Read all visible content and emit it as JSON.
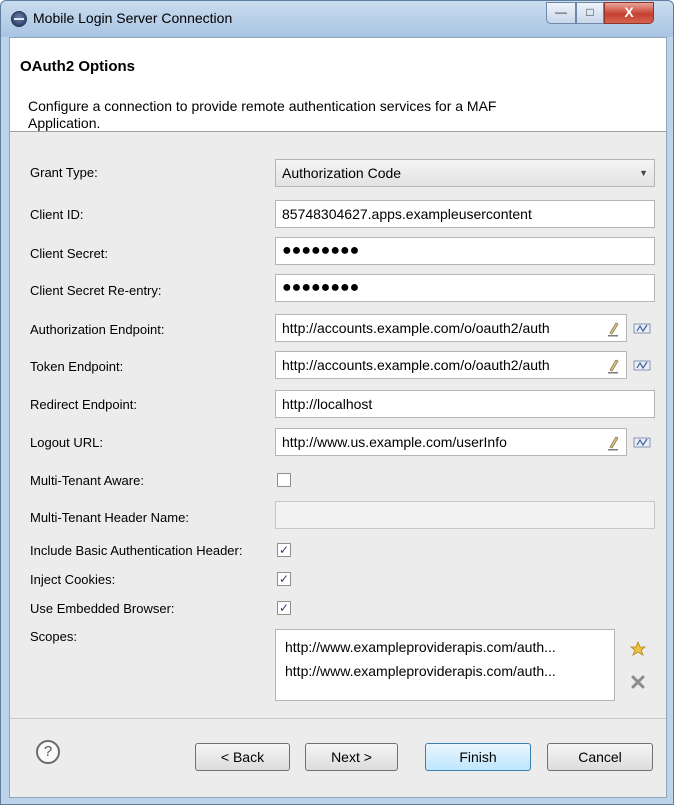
{
  "window": {
    "title": "Mobile Login Server Connection",
    "minimize": "—",
    "maximize": "□",
    "close": "X"
  },
  "header": {
    "title": "OAuth2 Options",
    "description": "Configure a connection to provide remote authentication services for a MAF Application."
  },
  "form": {
    "grant_type": {
      "label": "Grant Type:",
      "value": "Authorization Code"
    },
    "client_id": {
      "label": "Client ID:",
      "value": "85748304627.apps.exampleusercontent"
    },
    "client_secret": {
      "label": "Client Secret:",
      "value": "●●●●●●●●"
    },
    "client_secret_reentry": {
      "label": "Client Secret Re-entry:",
      "value": "●●●●●●●●"
    },
    "authorization_endpoint": {
      "label": "Authorization Endpoint:",
      "value": "http://accounts.example.com/o/oauth2/auth"
    },
    "token_endpoint": {
      "label": "Token Endpoint:",
      "value": "http://accounts.example.com/o/oauth2/auth"
    },
    "redirect_endpoint": {
      "label": "Redirect Endpoint:",
      "value": "http://localhost"
    },
    "logout_url": {
      "label": "Logout URL:",
      "value": "http://www.us.example.com/userInfo"
    },
    "multi_tenant_aware": {
      "label": "Multi-Tenant Aware:",
      "checked": false
    },
    "multi_tenant_header": {
      "label": "Multi-Tenant Header Name:",
      "value": ""
    },
    "include_basic_auth": {
      "label": "Include Basic Authentication Header:",
      "checked": true
    },
    "inject_cookies": {
      "label": "Inject Cookies:",
      "checked": true
    },
    "use_embedded_browser": {
      "label": "Use Embedded Browser:",
      "checked": true
    },
    "scopes": {
      "label": "Scopes:",
      "items": [
        "http://www.exampleproviderapis.com/auth...",
        "http://www.exampleproviderapis.com/auth..."
      ]
    },
    "check_mark": "✓",
    "select_arrow": "▼"
  },
  "buttons": {
    "help": "?",
    "back": "< Back",
    "next": "Next >",
    "finish": "Finish",
    "cancel": "Cancel"
  },
  "icons": {
    "window": "app-icon",
    "edit": "edit-icon",
    "variable": "variable-icon",
    "add": "add-scope-icon",
    "remove": "remove-scope-icon"
  }
}
